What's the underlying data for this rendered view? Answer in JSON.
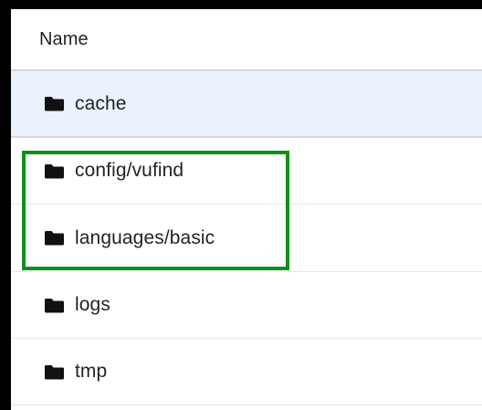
{
  "table": {
    "header": {
      "name_label": "Name"
    },
    "rows": [
      {
        "name": "cache",
        "icon": "folder-icon",
        "selected": true
      },
      {
        "name": "config/vufind",
        "icon": "folder-icon",
        "selected": false
      },
      {
        "name": "languages/basic",
        "icon": "folder-icon",
        "selected": false
      },
      {
        "name": "logs",
        "icon": "folder-icon",
        "selected": false
      },
      {
        "name": "tmp",
        "icon": "folder-icon",
        "selected": false
      }
    ]
  },
  "colors": {
    "highlight_border": "#0c9118",
    "selected_row": "#eaf3fd",
    "text": "#1f2328"
  }
}
